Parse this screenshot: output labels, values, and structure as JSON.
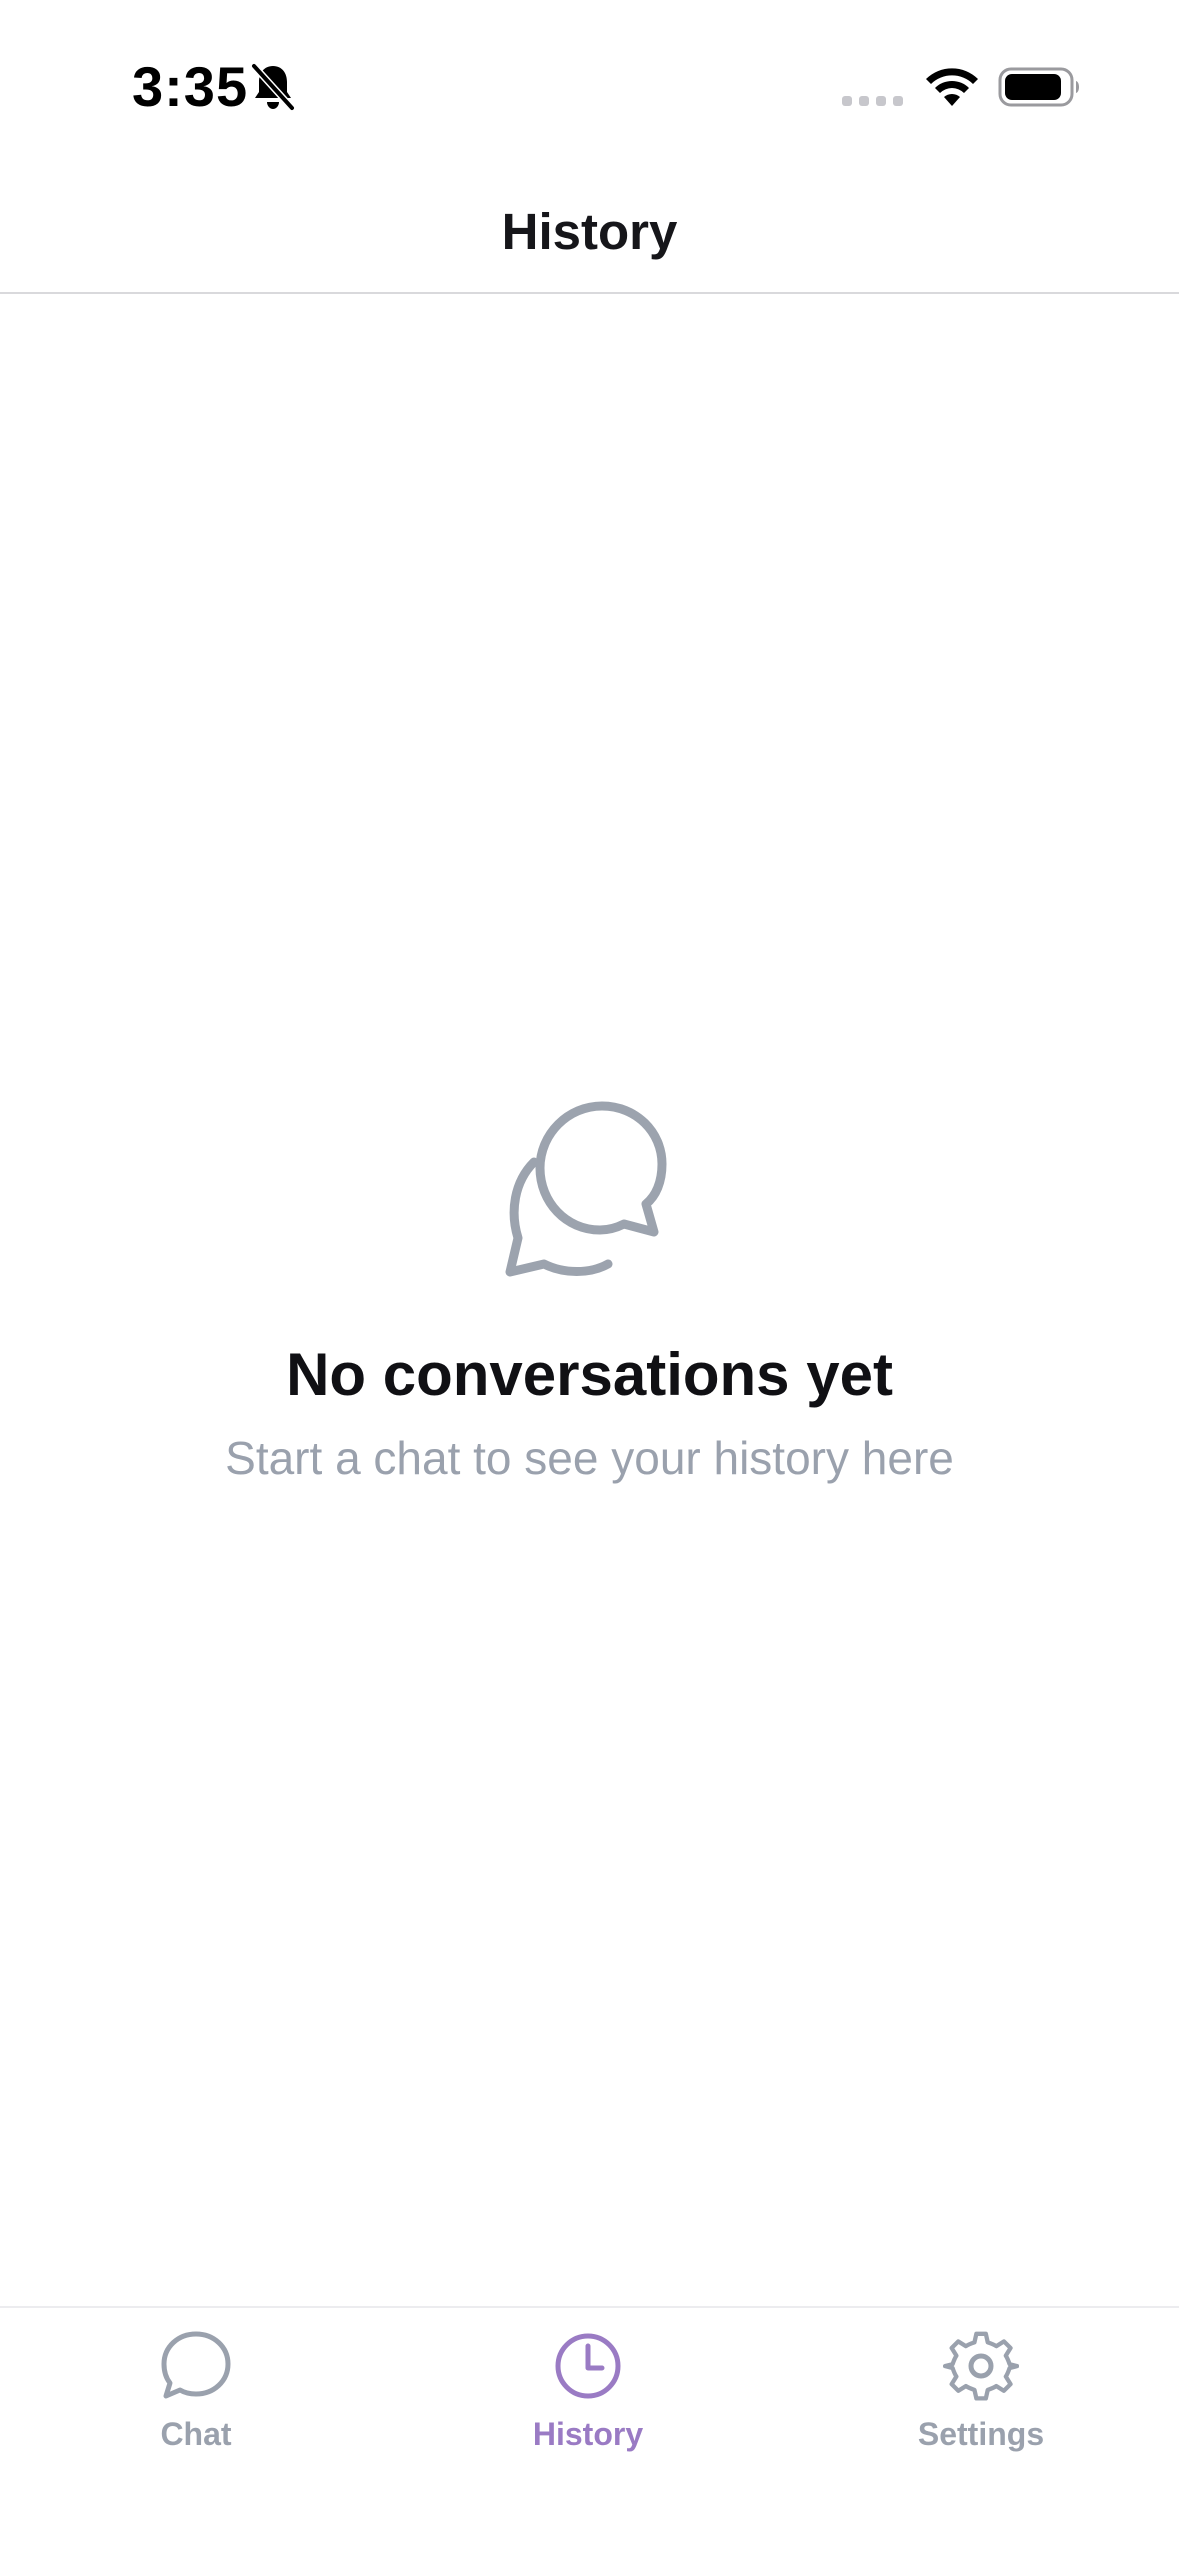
{
  "status_bar": {
    "time": "3:35",
    "icons": [
      "bell-slash-icon",
      "signal-icon",
      "wifi-icon",
      "battery-icon"
    ]
  },
  "header": {
    "title": "History"
  },
  "empty_state": {
    "icon": "chat-bubble-icon",
    "title": "No conversations yet",
    "subtitle": "Start a chat to see your history here"
  },
  "tab_bar": {
    "tabs": [
      {
        "label": "Chat",
        "icon": "chat-icon",
        "active": false
      },
      {
        "label": "History",
        "icon": "clock-icon",
        "active": true
      },
      {
        "label": "Settings",
        "icon": "gear-icon",
        "active": false
      }
    ]
  },
  "colors": {
    "accent": "#9a7bc4",
    "muted": "#9aa1ad",
    "text": "#101014"
  }
}
